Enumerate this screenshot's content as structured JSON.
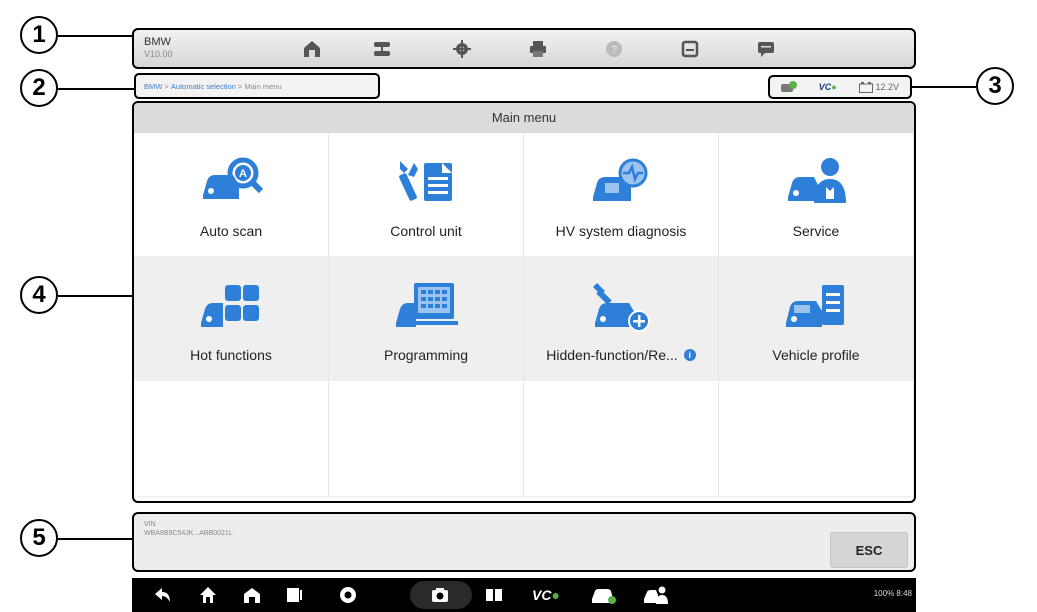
{
  "callouts": [
    "1",
    "2",
    "3",
    "4",
    "5"
  ],
  "toolbar": {
    "vehicle_make": "BMW",
    "version": "V10.00",
    "icons": [
      "home-icon",
      "vehicle-swap-icon",
      "settings-icon",
      "print-icon",
      "help-icon",
      "save-icon",
      "data-logging-icon"
    ]
  },
  "breadcrumb": {
    "make": "BMW",
    "sep1": " > ",
    "step": "Automatic selection",
    "sep2": " > ",
    "current": "Main menu"
  },
  "status": {
    "vci_label": "VC",
    "voltage": "12.2V"
  },
  "main": {
    "title": "Main menu",
    "tiles": [
      {
        "label": "Auto scan",
        "icon": "auto-scan-icon"
      },
      {
        "label": "Control unit",
        "icon": "control-unit-icon"
      },
      {
        "label": "HV system diagnosis",
        "icon": "hv-system-icon"
      },
      {
        "label": "Service",
        "icon": "service-icon"
      },
      {
        "label": "Hot functions",
        "icon": "hot-functions-icon"
      },
      {
        "label": "Programming",
        "icon": "programming-icon"
      },
      {
        "label": "Hidden-function/Re...",
        "icon": "hidden-function-icon",
        "info": "i"
      },
      {
        "label": "Vehicle profile",
        "icon": "vehicle-profile-icon"
      }
    ]
  },
  "message": {
    "line1": "VIN",
    "line2": "WBA8B9C54JK...ABB0021L",
    "esc_label": "ESC"
  },
  "navbar": {
    "vci_label": "VC",
    "system": "100% 8:48"
  },
  "colors": {
    "accent_blue": "#2e7fd8",
    "link_blue": "#3b7fd1",
    "vci_green": "#5bb146"
  }
}
